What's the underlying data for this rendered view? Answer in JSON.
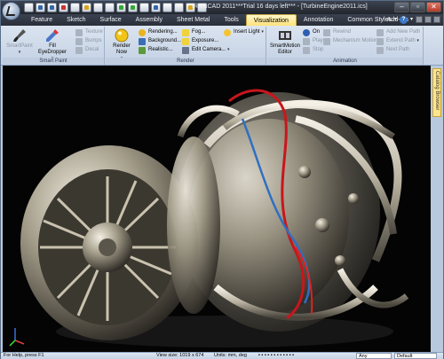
{
  "window": {
    "title": "IRONCAD 2011***Trial 16 days left*** - [TurbineEngine2011.ics]",
    "controls": [
      "–",
      "▫",
      "✕"
    ]
  },
  "tabs": [
    "Feature",
    "Sketch",
    "Surface",
    "Assembly",
    "Sheet Metal",
    "Tools",
    "Visualization",
    "Annotation",
    "Common",
    "Add-Ins"
  ],
  "active_tab": "Visualization",
  "styles_label": "Styles",
  "ribbon": {
    "smart_paint": {
      "label": "Smart Paint",
      "smartpaint": "SmartPaint",
      "fill_eyedropper": "Fill EyeDropper",
      "texture": "Texture",
      "bumps": "Bumps",
      "decal": "Decal"
    },
    "render": {
      "label": "Render",
      "render_now": "Render Now",
      "rendering": "Rendering...",
      "background": "Background...",
      "realistic": "Realistic...",
      "fog": "Fog...",
      "exposure": "Exposure...",
      "edit_camera": "Edit Camera...",
      "insert_light": "Insert Light"
    },
    "animation": {
      "label": "Animation",
      "smartmotion_editor": "SmartMotion Editor",
      "on": "On",
      "play": "Play",
      "stop": "Stop",
      "rewind": "Rewind",
      "mechanism_motion": "Mechanism Motion",
      "add_new_path": "Add New Path",
      "extend_path": "Extend Path",
      "next_path": "Next Path"
    }
  },
  "side_panel": "Catalog Browser",
  "status": {
    "help": "For Help, press F1",
    "view_size": "View size: 1019 x 674",
    "units": "Units: mm, deg",
    "filter": "Any",
    "style": "Default"
  }
}
